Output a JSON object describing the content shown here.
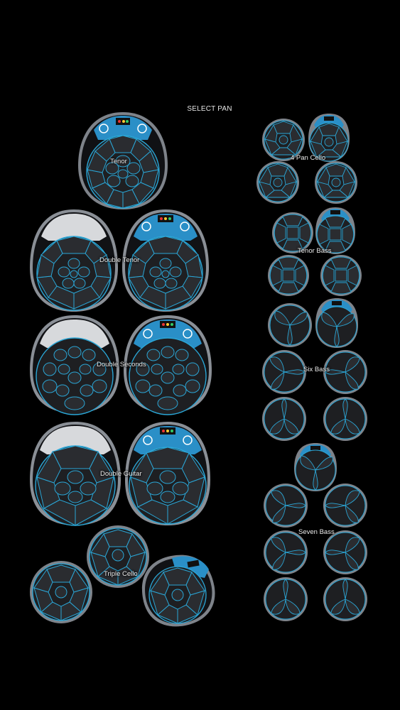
{
  "header": {
    "title": "SELECT PAN"
  },
  "pans": {
    "tenor": {
      "label": "Tenor"
    },
    "double_tenor": {
      "label": "Double Tenor"
    },
    "double_seconds": {
      "label": "Double Seconds"
    },
    "double_guitar": {
      "label": "Double Guitar"
    },
    "triple_cello": {
      "label": "Triple Cello"
    },
    "four_pan_cello": {
      "label": "4 Pan Cello"
    },
    "tenor_bass": {
      "label": "Tenor Bass"
    },
    "six_bass": {
      "label": "Six Bass"
    },
    "seven_bass": {
      "label": "Seven Bass"
    }
  },
  "colors": {
    "background": "#000000",
    "note_outline": "#2aa6d6",
    "rim": "#8c9198",
    "drum_face": "#1e1f22",
    "note_fill": "#2a2c30",
    "badge_blue": "#2a8fc7"
  }
}
